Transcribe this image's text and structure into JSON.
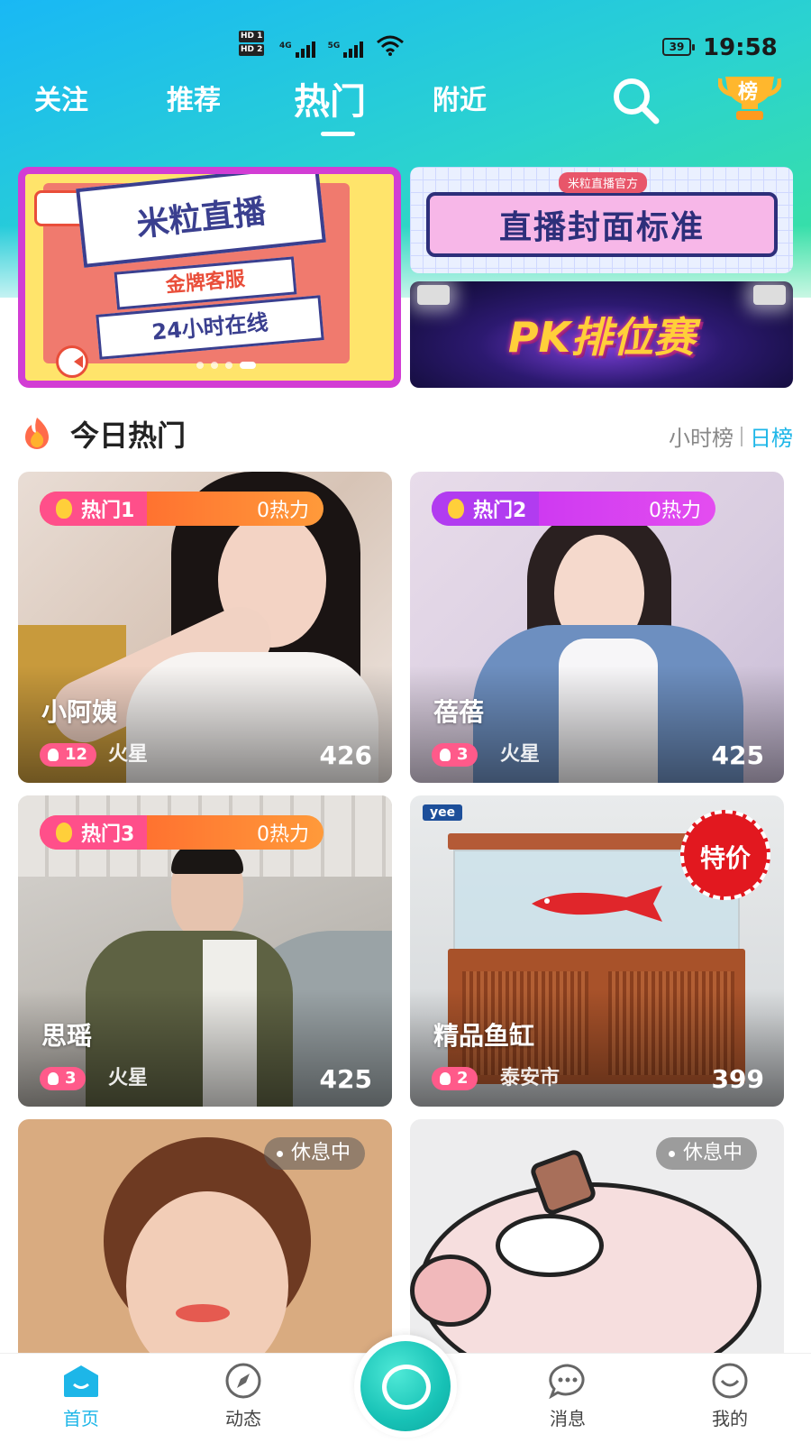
{
  "status_bar": {
    "net1": "HD 1",
    "net2": "HD 2",
    "sig1": "4G",
    "sig2": "5G",
    "battery": "39",
    "time": "19:58"
  },
  "tabs": [
    "关注",
    "推荐",
    "热门",
    "附近"
  ],
  "active_tab": "热门",
  "trophy_label": "榜",
  "banners": {
    "left": {
      "title": "米粒直播",
      "line1": "金牌客服",
      "line2": "24小时在线"
    },
    "right_top": {
      "tag": "米粒直播官方",
      "title": "直播封面标准"
    },
    "right_bottom": {
      "title": "PK排位赛"
    }
  },
  "section": {
    "title": "今日热门",
    "toggle_hour": "小时榜",
    "toggle_day": "日榜",
    "active_toggle": "日榜"
  },
  "cards": [
    {
      "badge": "热门1",
      "heat": "0热力",
      "name": "小阿姨",
      "level": "12",
      "location": "火星",
      "count": "426"
    },
    {
      "badge": "热门2",
      "heat": "0热力",
      "name": "蓓蓓",
      "level": "3",
      "location": "火星",
      "count": "425"
    },
    {
      "badge": "热门3",
      "heat": "0热力",
      "name": "思瑶",
      "level": "3",
      "location": "火星",
      "count": "425"
    },
    {
      "badge": "",
      "heat": "",
      "name": "精品鱼缸",
      "level": "2",
      "location": "泰安市",
      "count": "399",
      "stamp": "特价",
      "brand": "yee"
    },
    {
      "status": "休息中"
    },
    {
      "status": "休息中"
    }
  ],
  "nav": [
    "首页",
    "动态",
    "消息",
    "我的"
  ],
  "active_nav": "首页",
  "colors": {
    "accent": "#1db6e8",
    "gradient_start": "#19b8f5",
    "gradient_end": "#3be39c",
    "live_button": "#17c2b6"
  }
}
